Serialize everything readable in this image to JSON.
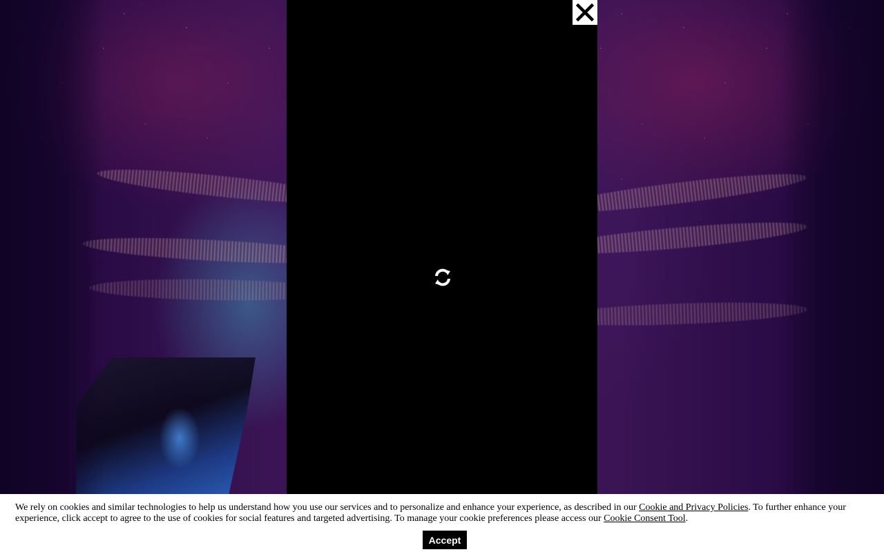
{
  "overlay": {
    "close_icon": "close-icon",
    "loading_icon": "refresh-spinner-icon"
  },
  "cookie_banner": {
    "text_before_link1": "We rely on cookies and similar technologies to help us understand how you use our services and to personalize and enhance your experience, as described in our ",
    "link1_label": "Cookie and Privacy Policies",
    "text_between_links": ". To further enhance your experience, click accept to agree to the use of cookies for social features and targeted advertising. To manage your cookie preferences please access our ",
    "link2_label": "Cookie Consent Tool",
    "text_after_link2": ".",
    "accept_label": "Accept"
  },
  "colors": {
    "panel_background": "#000000",
    "banner_background": "#ffffff",
    "accept_button": "#000000",
    "background_purple": "#3a1454"
  }
}
